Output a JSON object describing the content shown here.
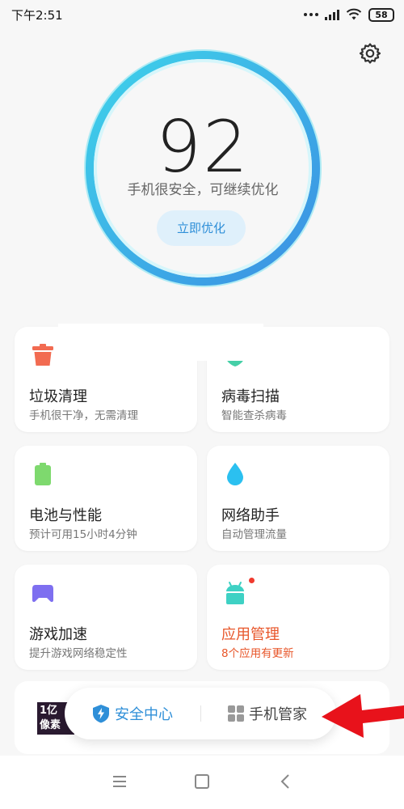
{
  "status_bar": {
    "time": "下午2:51",
    "battery": "58",
    "icons": [
      "dots-icon",
      "signal-icon",
      "wifi-icon",
      "battery-icon"
    ]
  },
  "header": {
    "settings_icon": "gear-icon"
  },
  "score": {
    "value": "92",
    "description": "手机很安全，可继续优化",
    "button_label": "立即优化",
    "ring_colors": [
      "#3fd3ea",
      "#3b8fe3"
    ]
  },
  "cards": [
    {
      "icon": "trash-icon",
      "title": "垃圾清理",
      "subtitle": "手机很干净，无需清理",
      "color": "#f26b51"
    },
    {
      "icon": "shield-scan-icon",
      "title": "病毒扫描",
      "subtitle": "智能查杀病毒",
      "color": "#45cfa7"
    },
    {
      "icon": "battery-icon",
      "title": "电池与性能",
      "subtitle": "预计可用15小时4分钟",
      "color": "#7ed96e"
    },
    {
      "icon": "water-drop-icon",
      "title": "网络助手",
      "subtitle": "自动管理流量",
      "color": "#2bc0f0"
    },
    {
      "icon": "gamepad-icon",
      "title": "游戏加速",
      "subtitle": "提升游戏网络稳定性",
      "color": "#7e6ff0"
    },
    {
      "icon": "android-icon",
      "title": "应用管理",
      "subtitle": "8个应用有更新",
      "color": "#3ed1c4",
      "highlight": "#e8562a"
    }
  ],
  "ad": {
    "thumb_text": "1亿\n像素"
  },
  "switch_bar": {
    "left_label": "安全中心",
    "right_label": "手机管家",
    "left_icon": "shield-bolt-icon",
    "right_icon": "grid-icon"
  },
  "annotation": {
    "arrow_color": "#e8121b"
  },
  "nav_bar": {
    "icons": [
      "menu-icon",
      "home-icon",
      "back-icon"
    ]
  }
}
